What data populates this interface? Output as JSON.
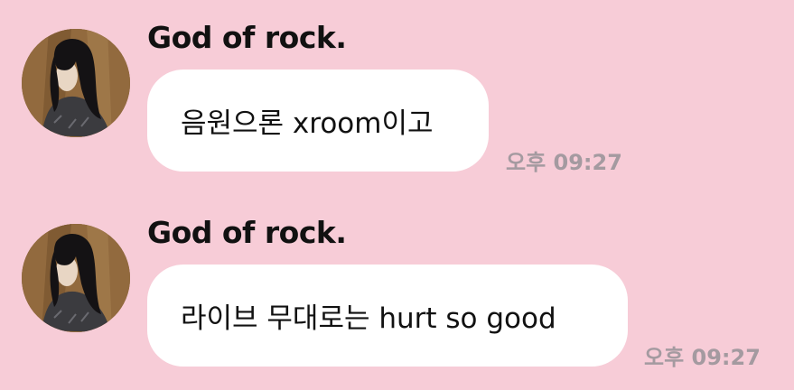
{
  "messages": [
    {
      "sender": "God of rock.",
      "text": "음원으론 xroom이고",
      "time": "오후 09:27",
      "avatar_icon": "profile-photo"
    },
    {
      "sender": "God of rock.",
      "text": "라이브 무대로는 hurt so good",
      "time": "오후 09:27",
      "avatar_icon": "profile-photo"
    }
  ],
  "colors": {
    "background": "#f7ccd7",
    "bubble": "#ffffff",
    "sender_text": "#111111",
    "message_text": "#111111",
    "timestamp": "#a49aa0"
  }
}
